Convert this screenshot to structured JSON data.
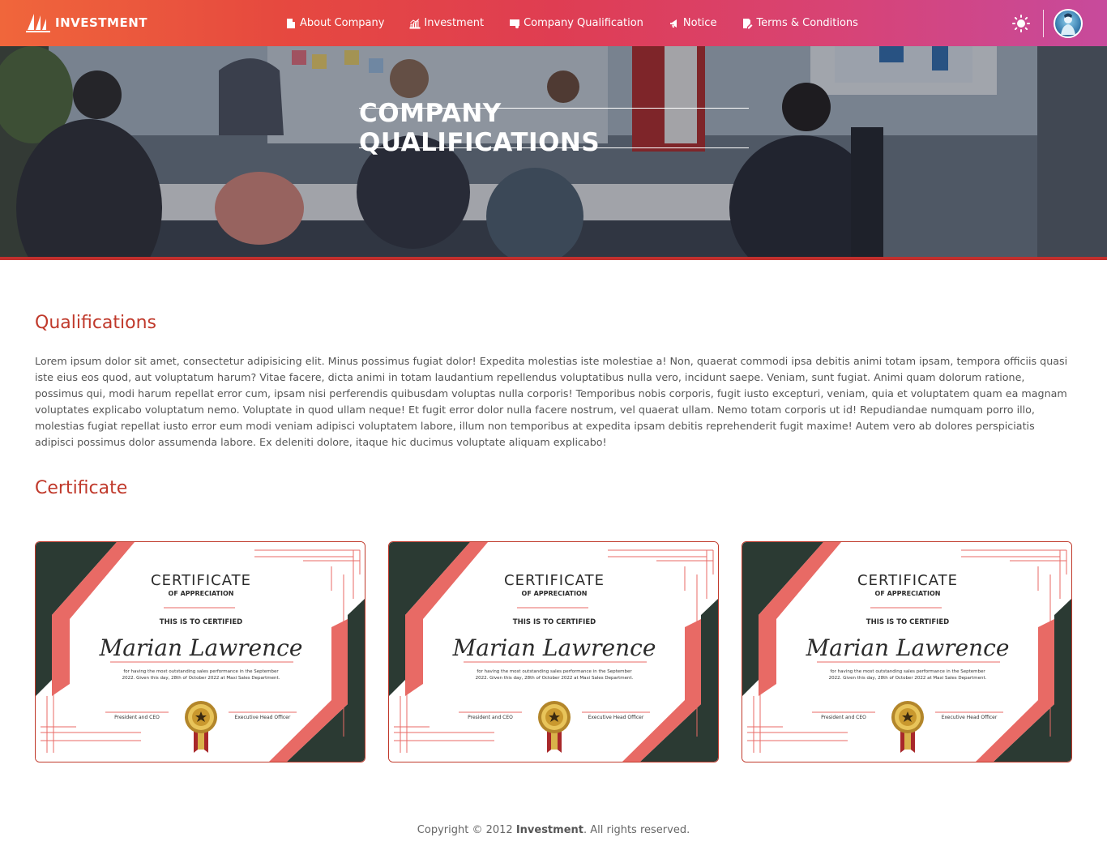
{
  "navbar": {
    "brand": "INVESTMENT",
    "items": [
      {
        "label": "About Company",
        "icon": "building-icon"
      },
      {
        "label": "Investment",
        "icon": "chart-icon"
      },
      {
        "label": "Company Qualification",
        "icon": "certificate-icon"
      },
      {
        "label": "Notice",
        "icon": "megaphone-icon"
      },
      {
        "label": "Terms & Conditions",
        "icon": "edit-document-icon"
      }
    ],
    "theme_icon": "sun-icon",
    "avatar_icon": "user-avatar"
  },
  "hero": {
    "title": "COMPANY QUALIFICATIONS"
  },
  "main": {
    "qualifications_title": "Qualifications",
    "qualifications_text": "Lorem ipsum dolor sit amet, consectetur adipisicing elit. Minus possimus fugiat dolor! Expedita molestias iste molestiae a! Non, quaerat commodi ipsa debitis animi totam ipsam, tempora officiis quasi iste eius eos quod, aut voluptatum harum? Vitae facere, dicta animi in totam laudantium repellendus voluptatibus nulla vero, incidunt saepe. Veniam, sunt fugiat. Animi quam dolorum ratione, possimus qui, modi harum repellat error cum, ipsam nisi perferendis quibusdam voluptas nulla corporis! Temporibus nobis corporis, fugit iusto excepturi, veniam, quia et voluptatem quam ea magnam voluptates explicabo voluptatum nemo. Voluptate in quod ullam neque! Et fugit error dolor nulla facere nostrum, vel quaerat ullam. Nemo totam corporis ut id! Repudiandae numquam porro illo, molestias fugiat repellat iusto error eum modi veniam adipisci voluptatem labore, illum non temporibus at expedita ipsam debitis reprehenderit fugit maxime! Autem vero ab dolores perspiciatis adipisci possimus dolor assumenda labore. Ex deleniti dolore, itaque hic ducimus voluptate aliquam explicabo!",
    "certificate_title": "Certificate"
  },
  "certificate": {
    "heading": "CERTIFICATE",
    "subheading": "OF APPRECIATION",
    "certify": "THIS IS TO CERTIFIED",
    "name": "Marian Lawrence",
    "line1": "for having the most outstanding sales performance in the  September",
    "line2": "2022. Given this day, 28th of October 2022 at Maxi Sales Department.",
    "sign_left": "President and CEO",
    "sign_right": "Executive Head Officer",
    "colors": {
      "dark": "#2b3a33",
      "accent": "#e86a65",
      "border": "#c0392b"
    }
  },
  "footer": {
    "prefix": "Copyright © 2012 ",
    "brand": "Investment",
    "suffix": ". All rights reserved."
  }
}
